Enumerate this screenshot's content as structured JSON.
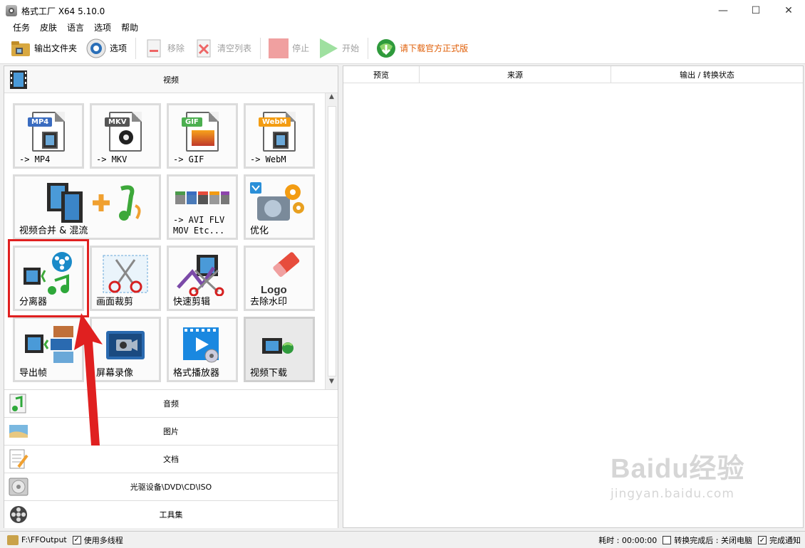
{
  "window": {
    "title": "格式工厂 X64 5.10.0",
    "minimize": "—",
    "maximize": "☐",
    "close": "✕"
  },
  "menu": [
    "任务",
    "皮肤",
    "语言",
    "选项",
    "帮助"
  ],
  "toolbar": {
    "output_folder": "输出文件夹",
    "options": "选项",
    "remove": "移除",
    "clear_list": "清空列表",
    "stop": "停止",
    "start": "开始",
    "download_official": "请下载官方正式版"
  },
  "categories": {
    "video": "视频",
    "audio": "音频",
    "image": "图片",
    "document": "文档",
    "optical": "光驱设备\\DVD\\CD\\ISO",
    "tools": "工具集"
  },
  "tiles": {
    "mp4": {
      "label": "-> MP4",
      "badge": "MP4"
    },
    "mkv": {
      "label": "-> MKV",
      "badge": "MKV"
    },
    "gif": {
      "label": "-> GIF",
      "badge": "GIF"
    },
    "webm": {
      "label": "-> WebM",
      "badge": "WebM"
    },
    "merge": {
      "label": "视频合并 & 混流"
    },
    "avi": {
      "label": "-> AVI FLV\nMOV Etc..."
    },
    "optimize": {
      "label": "优化"
    },
    "splitter": {
      "label": "分离器"
    },
    "crop": {
      "label": "画面裁剪"
    },
    "quickcut": {
      "label": "快速剪辑"
    },
    "watermark": {
      "label": "去除水印",
      "logo": "Logo"
    },
    "frames": {
      "label": "导出帧"
    },
    "record": {
      "label": "屏幕录像"
    },
    "player": {
      "label": "格式播放器"
    },
    "download": {
      "label": "视频下载"
    }
  },
  "table": {
    "col_preview": "预览",
    "col_source": "来源",
    "col_output": "输出 / 转换状态"
  },
  "watermark": {
    "line1": "Baidu经验",
    "line2": "jingyan.baidu.com"
  },
  "status": {
    "path": "F:\\FFOutput",
    "multithread": "使用多线程",
    "elapsed": "耗时 : 00:00:00",
    "after_convert": "转换完成后 : 关闭电脑",
    "notify": "完成通知"
  },
  "colors": {
    "accent_red": "#e02020",
    "link_orange": "#e0600a"
  }
}
